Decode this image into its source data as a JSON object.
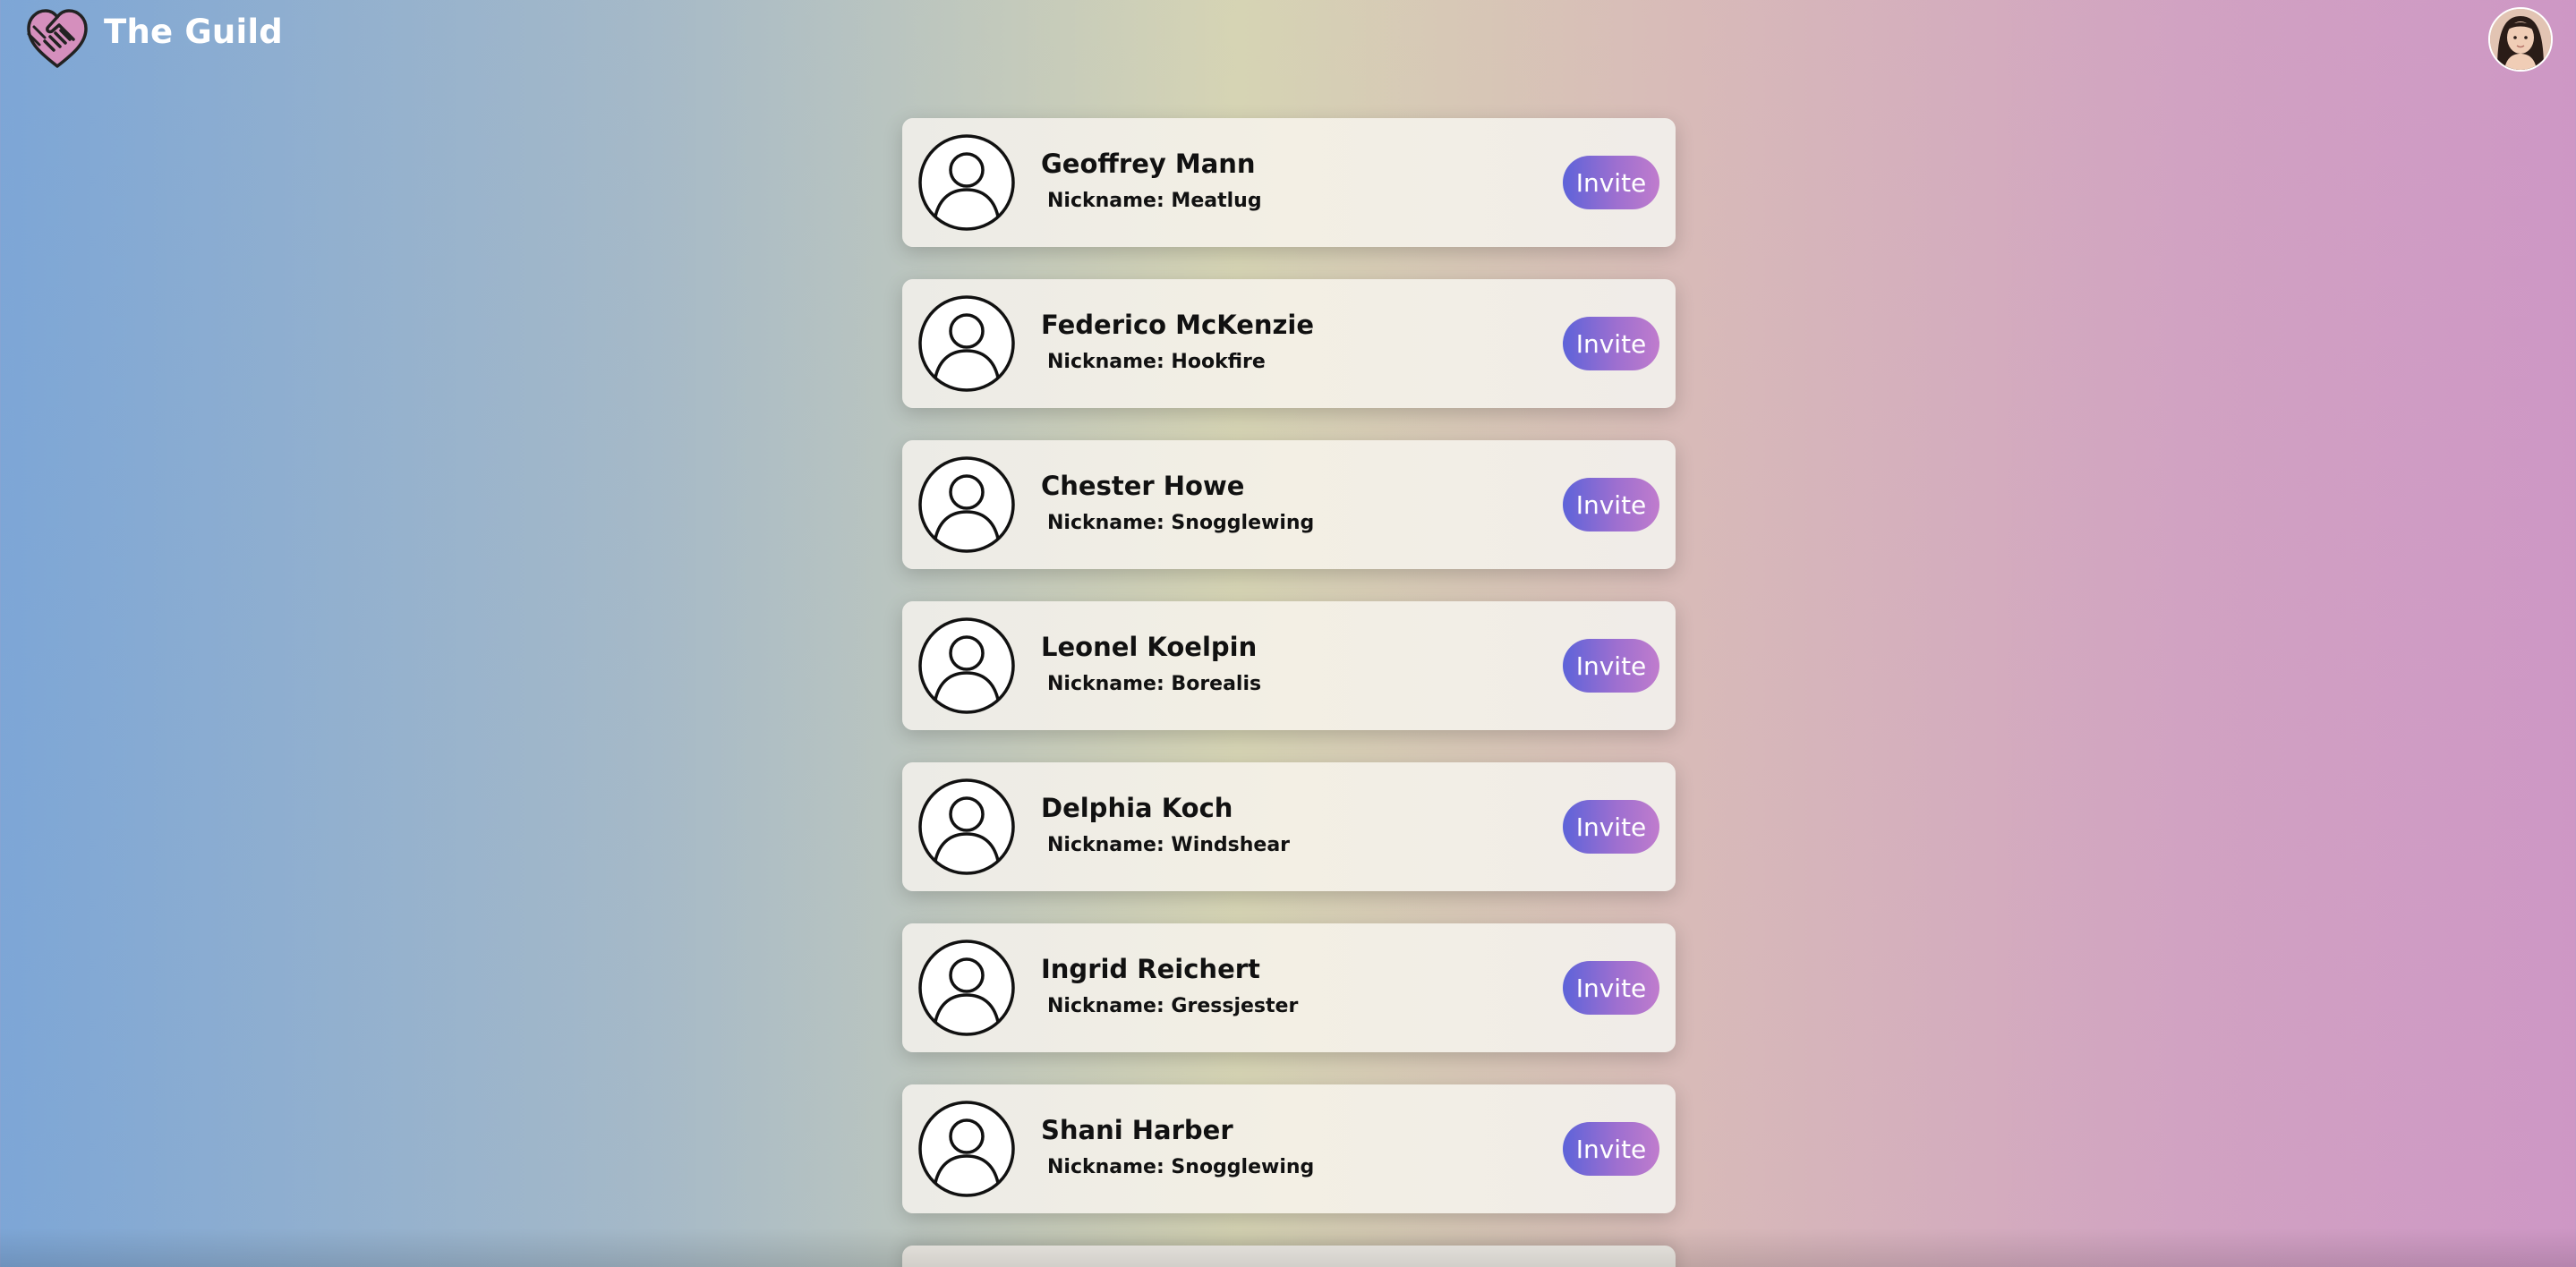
{
  "app": {
    "title": "The Guild",
    "logo_icon": "heart-handshake-icon",
    "user_avatar": "user-avatar-photo"
  },
  "colors": {
    "background_left": "#7da6d6",
    "background_mid": "#d6d4b4",
    "background_right": "#ce97c5",
    "invite_start": "#5d63d9",
    "invite_end": "#c07ccd",
    "card": "#f1eee6"
  },
  "members": [
    {
      "name": "Geoffrey Mann",
      "nickname": "Nickname: Meatlug",
      "action": "Invite"
    },
    {
      "name": "Federico McKenzie",
      "nickname": "Nickname: Hookfire",
      "action": "Invite"
    },
    {
      "name": "Chester Howe",
      "nickname": "Nickname: Snogglewing",
      "action": "Invite"
    },
    {
      "name": "Leonel Koelpin",
      "nickname": "Nickname: Borealis",
      "action": "Invite"
    },
    {
      "name": "Delphia Koch",
      "nickname": "Nickname: Windshear",
      "action": "Invite"
    },
    {
      "name": "Ingrid Reichert",
      "nickname": "Nickname: Gressjester",
      "action": "Invite"
    },
    {
      "name": "Shani Harber",
      "nickname": "Nickname: Snogglewing",
      "action": "Invite"
    }
  ]
}
